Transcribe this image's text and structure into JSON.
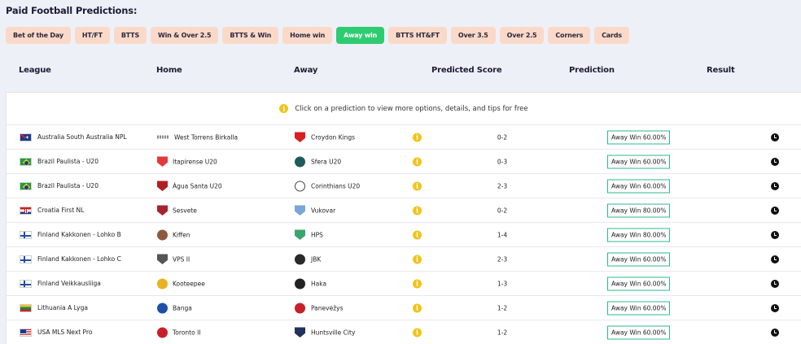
{
  "page": {
    "title": "Paid Football Predictions:"
  },
  "filters": [
    {
      "label": "Bet of the Day",
      "active": false
    },
    {
      "label": "HT/FT",
      "active": false
    },
    {
      "label": "BTTS",
      "active": false
    },
    {
      "label": "Win & Over 2.5",
      "active": false
    },
    {
      "label": "BTTS & Win",
      "active": false
    },
    {
      "label": "Home win",
      "active": false
    },
    {
      "label": "Away win",
      "active": true
    },
    {
      "label": "BTTS HT&FT",
      "active": false
    },
    {
      "label": "Over 3.5",
      "active": false
    },
    {
      "label": "Over 2.5",
      "active": false
    },
    {
      "label": "Corners",
      "active": false
    },
    {
      "label": "Cards",
      "active": false
    }
  ],
  "columns": {
    "league": "League",
    "home": "Home",
    "away": "Away",
    "predicted_score": "Predicted Score",
    "prediction": "Prediction",
    "result": "Result"
  },
  "notice": "Click on a prediction to view more options, details, and tips for free",
  "rows": [
    {
      "flag": "australia-flag-icon",
      "league": "Australia South Australia NPL",
      "home_icon": "west-torrens-birkalla-crest-icon",
      "home": "West Torrens Birkalla",
      "away_icon": "croydon-kings-crest-icon",
      "away": "Croydon Kings",
      "score": "0-2",
      "prediction": "Away Win 60.00%"
    },
    {
      "flag": "brazil-flag-icon",
      "league": "Brazil Paulista - U20",
      "home_icon": "itapirense-crest-icon",
      "home": "Itapirense U20",
      "away_icon": "sfera-crest-icon",
      "away": "Sfera U20",
      "score": "0-3",
      "prediction": "Away Win 60.00%"
    },
    {
      "flag": "brazil-flag-icon",
      "league": "Brazil Paulista - U20",
      "home_icon": "agua-santa-crest-icon",
      "home": "Água Santa U20",
      "away_icon": "corinthians-crest-icon",
      "away": "Corinthians U20",
      "score": "2-3",
      "prediction": "Away Win 60.00%"
    },
    {
      "flag": "croatia-flag-icon",
      "league": "Croatia First NL",
      "home_icon": "sesvete-crest-icon",
      "home": "Sesvete",
      "away_icon": "vukovar-crest-icon",
      "away": "Vukovar",
      "score": "0-2",
      "prediction": "Away Win 80.00%"
    },
    {
      "flag": "finland-flag-icon",
      "league": "Finland Kakkonen - Lohko B",
      "home_icon": "kiffen-crest-icon",
      "home": "Kiffen",
      "away_icon": "hps-crest-icon",
      "away": "HPS",
      "score": "1-4",
      "prediction": "Away Win 80.00%"
    },
    {
      "flag": "finland-flag-icon",
      "league": "Finland Kakkonen - Lohko C",
      "home_icon": "vps-ii-crest-icon",
      "home": "VPS II",
      "away_icon": "jbk-crest-icon",
      "away": "JBK",
      "score": "2-3",
      "prediction": "Away Win 60.00%"
    },
    {
      "flag": "finland-flag-icon",
      "league": "Finland Veikkausliiga",
      "home_icon": "kooteepee-crest-icon",
      "home": "Kooteepee",
      "away_icon": "haka-crest-icon",
      "away": "Haka",
      "score": "1-3",
      "prediction": "Away Win 60.00%"
    },
    {
      "flag": "lithuania-flag-icon",
      "league": "Lithuania A Lyga",
      "home_icon": "banga-crest-icon",
      "home": "Banga",
      "away_icon": "panevezys-crest-icon",
      "away": "Panevėžys",
      "score": "1-2",
      "prediction": "Away Win 60.00%"
    },
    {
      "flag": "usa-flag-icon",
      "league": "USA MLS Next Pro",
      "home_icon": "toronto-ii-crest-icon",
      "home": "Toronto II",
      "away_icon": "huntsville-city-crest-icon",
      "away": "Huntsville City",
      "score": "1-2",
      "prediction": "Away Win 60.00%"
    }
  ],
  "colors": {
    "page_bg": "#eef0f8",
    "filter_bg": "#fbd9c8",
    "filter_active_bg": "#2ecc71",
    "prediction_border": "#2eb88a",
    "info_icon": "#f0c419"
  }
}
